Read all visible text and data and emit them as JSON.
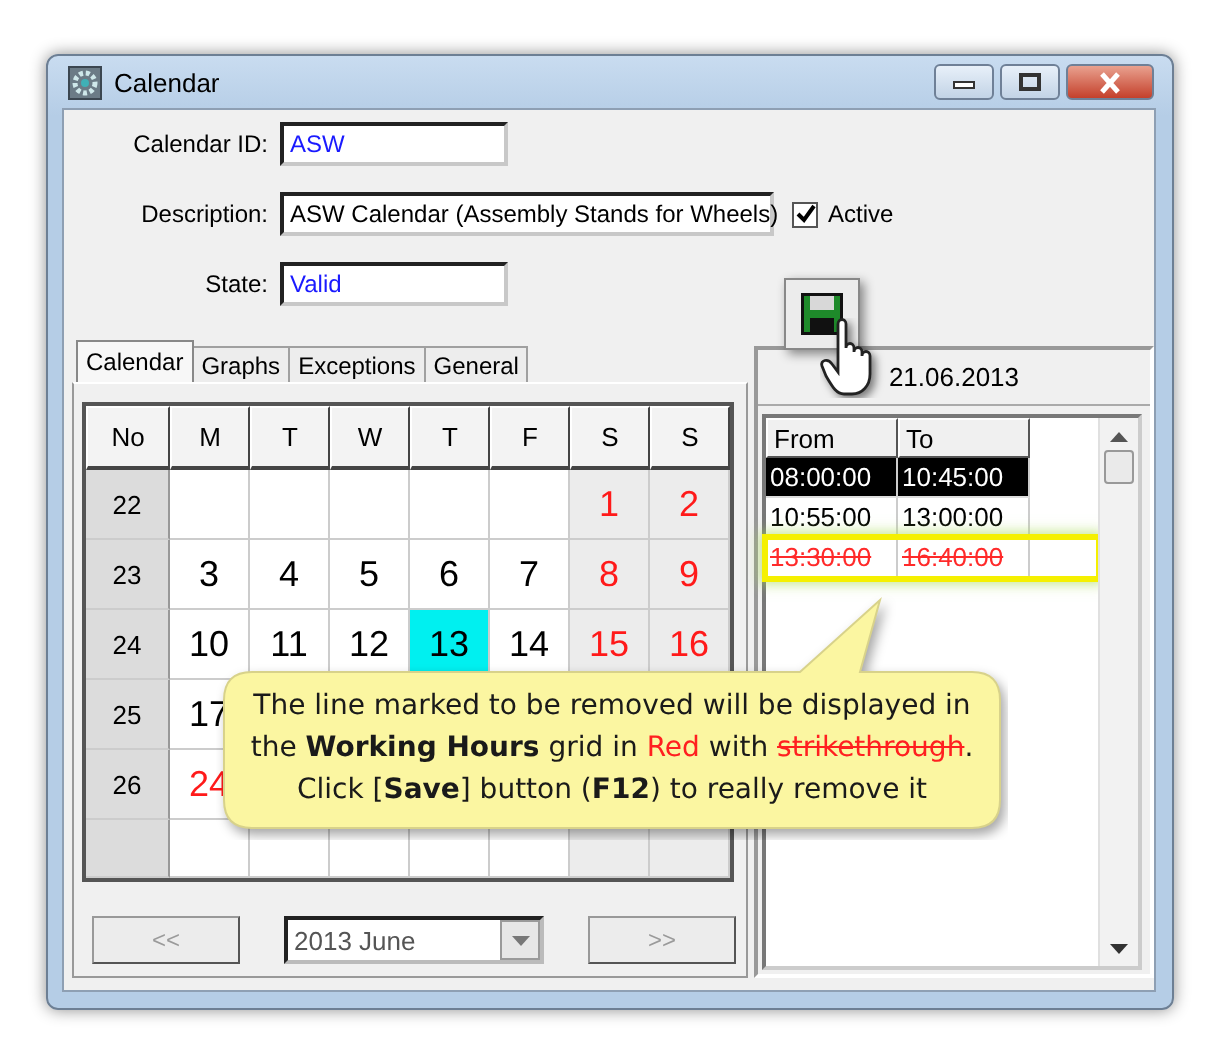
{
  "window": {
    "title": "Calendar"
  },
  "form": {
    "calendar_id": {
      "label": "Calendar ID:",
      "value": "ASW"
    },
    "description": {
      "label": "Description:",
      "value": "ASW Calendar (Assembly Stands for Wheels)"
    },
    "active": {
      "label": "Active",
      "checked": true
    },
    "state": {
      "label": "State:",
      "value": "Valid"
    }
  },
  "tabs": [
    {
      "label": "Calendar",
      "selected": true
    },
    {
      "label": "Graphs",
      "selected": false
    },
    {
      "label": "Exceptions",
      "selected": false
    },
    {
      "label": "General",
      "selected": false
    }
  ],
  "calendar": {
    "columns": [
      "No",
      "M",
      "T",
      "W",
      "T",
      "F",
      "S",
      "S"
    ],
    "weeks": [
      {
        "no": "22",
        "days": [
          {
            "day": "1",
            "kind": "holiday",
            "selected": false
          },
          {
            "day": "2",
            "kind": "holiday",
            "selected": false
          }
        ]
      },
      {
        "no": "23",
        "days": [
          {
            "day": "3",
            "kind": "workday",
            "selected": false
          },
          {
            "day": "4",
            "kind": "workday",
            "selected": false
          },
          {
            "day": "5",
            "kind": "workday",
            "selected": false
          },
          {
            "day": "6",
            "kind": "workday",
            "selected": false
          },
          {
            "day": "7",
            "kind": "workday",
            "selected": false
          },
          {
            "day": "8",
            "kind": "holiday",
            "selected": false
          },
          {
            "day": "9",
            "kind": "holiday",
            "selected": false
          }
        ]
      },
      {
        "no": "24",
        "days": [
          {
            "day": "10",
            "kind": "workday",
            "selected": false
          },
          {
            "day": "11",
            "kind": "workday",
            "selected": false
          },
          {
            "day": "12",
            "kind": "workday",
            "selected": false
          },
          {
            "day": "13",
            "kind": "workday",
            "selected": true
          },
          {
            "day": "14",
            "kind": "workday",
            "selected": false
          },
          {
            "day": "15",
            "kind": "holiday",
            "selected": false
          },
          {
            "day": "16",
            "kind": "holiday",
            "selected": false
          }
        ]
      },
      {
        "no": "25",
        "days": [
          {
            "day": "17",
            "kind": "workday",
            "selected": false
          }
        ]
      },
      {
        "no": "26",
        "days": [
          {
            "day": "24",
            "kind": "holiday",
            "selected": false
          }
        ]
      }
    ],
    "prev_button": {
      "label": "<<",
      "disabled": true
    },
    "month": "2013 June",
    "next_button": {
      "label": ">>",
      "disabled": true
    }
  },
  "working_hours": {
    "date": "21.06.2013",
    "columns": [
      "From",
      "To"
    ],
    "rows": [
      {
        "from": "08:00:00",
        "to": "10:45:00",
        "selected": true,
        "removed": false
      },
      {
        "from": "10:55:00",
        "to": "13:00:00",
        "selected": false,
        "removed": false
      },
      {
        "from": "13:30:00",
        "to": "16:40:00",
        "selected": false,
        "removed": true
      }
    ]
  },
  "callout": {
    "lines": [
      [
        {
          "text": "The line marked to be removed will be displayed in",
          "kind": "plain"
        }
      ],
      [
        {
          "text": "the ",
          "kind": "plain"
        },
        {
          "text": "Working Hours",
          "kind": "bold"
        },
        {
          "text": " grid in ",
          "kind": "plain"
        },
        {
          "text": "Red",
          "kind": "red"
        },
        {
          "text": " with ",
          "kind": "plain"
        },
        {
          "text": "strikethrough",
          "kind": "strike"
        },
        {
          "text": ".",
          "kind": "plain"
        }
      ],
      [
        {
          "text": "Click [",
          "kind": "plain"
        },
        {
          "text": "Save",
          "kind": "bold"
        },
        {
          "text": "] button (",
          "kind": "plain"
        },
        {
          "text": "F12",
          "kind": "bold"
        },
        {
          "text": ") to really remove it",
          "kind": "plain"
        }
      ]
    ]
  }
}
